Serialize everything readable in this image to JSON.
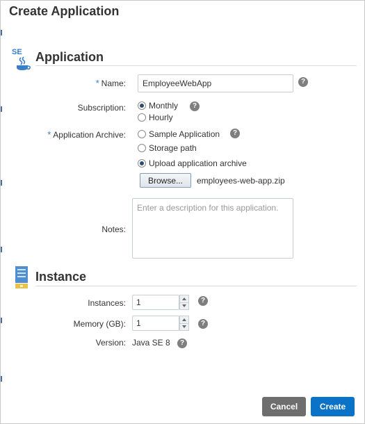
{
  "dialog": {
    "title": "Create Application"
  },
  "application_section": {
    "icon_text": "SE",
    "title": "Application",
    "name": {
      "label": "Name:",
      "value": "EmployeeWebApp"
    },
    "subscription": {
      "label": "Subscription:",
      "options": [
        "Monthly",
        "Hourly"
      ],
      "selected": "Monthly"
    },
    "archive": {
      "label": "Application Archive:",
      "options": [
        "Sample Application",
        "Storage path",
        "Upload application archive"
      ],
      "selected": "Upload application archive",
      "browse_label": "Browse...",
      "file_name": "employees-web-app.zip"
    },
    "notes": {
      "label": "Notes:",
      "placeholder": "Enter a description for this application."
    }
  },
  "instance_section": {
    "title": "Instance",
    "instances": {
      "label": "Instances:",
      "value": "1"
    },
    "memory": {
      "label": "Memory (GB):",
      "value": "1"
    },
    "version": {
      "label": "Version:",
      "value": "Java SE 8"
    }
  },
  "help_glyph": "?",
  "required_marker": "*",
  "footer": {
    "cancel_label": "Cancel",
    "create_label": "Create"
  },
  "colors": {
    "primary_button": "#0a72c7",
    "secondary_button": "#6e6e6e",
    "accent_icon": "#3a7dc9"
  }
}
